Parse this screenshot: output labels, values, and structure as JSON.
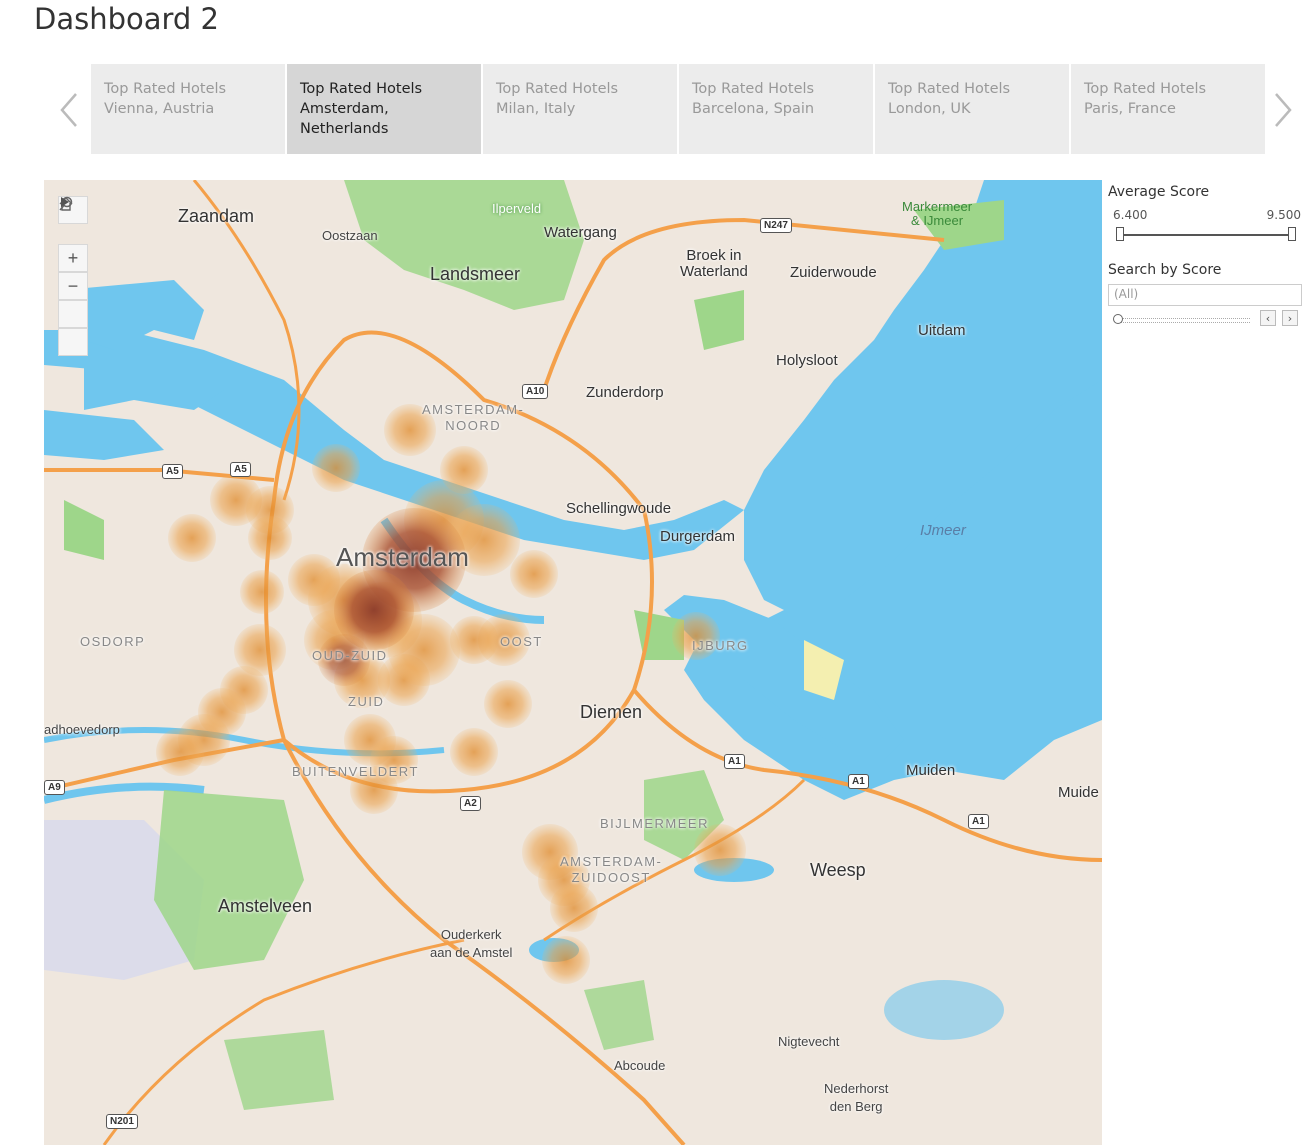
{
  "dashboard": {
    "title": "Dashboard 2"
  },
  "tabs": [
    {
      "label": "Top Rated Hotels\nVienna, Austria",
      "active": false
    },
    {
      "label": "Top Rated Hotels\nAmsterdam,\nNetherlands",
      "active": true
    },
    {
      "label": "Top Rated Hotels\nMilan, Italy",
      "active": false
    },
    {
      "label": "Top Rated Hotels\nBarcelona, Spain",
      "active": false
    },
    {
      "label": "Top Rated Hotels\nLondon, UK",
      "active": false
    },
    {
      "label": "Top Rated Hotels\nParis, France",
      "active": false
    }
  ],
  "map": {
    "places": {
      "zaandam": "Zaandam",
      "oostzaan": "Oostzaan",
      "landsmeer": "Landsmeer",
      "ilperveld": "Ilperveld",
      "watergang": "Watergang",
      "broek": "Broek in\nWaterland",
      "zuiderwoude": "Zuiderwoude",
      "markermeer": "Markermeer\n& IJmeer",
      "uitdam": "Uitdam",
      "holysloot": "Holysloot",
      "zunderdorp": "Zunderdorp",
      "amsterdam_noord": "AMSTERDAM-\nNOORD",
      "schellingwoude": "Schellingwoude",
      "durgerdam": "Durgerdam",
      "amsterdam": "Amsterdam",
      "osdorp": "OSDORP",
      "oud_zuid": "OUD-ZUID",
      "oost": "OOST",
      "ijburg": "IJBURG",
      "zuid": "ZUID",
      "badhoevedorp": "adhoevedorp",
      "diemen": "Diemen",
      "buitenveldert": "BUITENVELDERT",
      "bijlmermeer": "BIJLMERMEER",
      "amsterdam_zuidoost": "AMSTERDAM-\nZUIDOOST",
      "muiden": "Muiden",
      "muiden2": "Muide",
      "weesp": "Weesp",
      "amstelveen": "Amstelveen",
      "ouderkerk": "Ouderkerk\naan de Amstel",
      "nigtevecht": "Nigtevecht",
      "abcoude": "Abcoude",
      "nederhorst": "Nederhorst\nden Berg",
      "ijmeer": "IJmeer"
    },
    "shields": {
      "n247": "N247",
      "a10": "A10",
      "a5a": "A5",
      "a5b": "A5",
      "a1a": "A1",
      "a1b": "A1",
      "a1c": "A1",
      "a2": "A2",
      "a9": "A9",
      "n201": "N201"
    },
    "tools": {
      "search_icon": "magnifier-icon",
      "zoom_in": "+",
      "zoom_out": "−",
      "home": "home-icon",
      "pan": "play-icon"
    },
    "heat_color": "#e08a2a",
    "heat_core_color": "#8c3b2a",
    "water_color": "#6fc6ee",
    "park_color": "#9ed68a"
  },
  "filters": {
    "average_score": {
      "title": "Average Score",
      "min": "6.400",
      "max": "9.500"
    },
    "search_by_score": {
      "title": "Search by Score",
      "value": "(All)",
      "prev_icon": "chevron-left-icon",
      "next_icon": "chevron-right-icon"
    }
  }
}
